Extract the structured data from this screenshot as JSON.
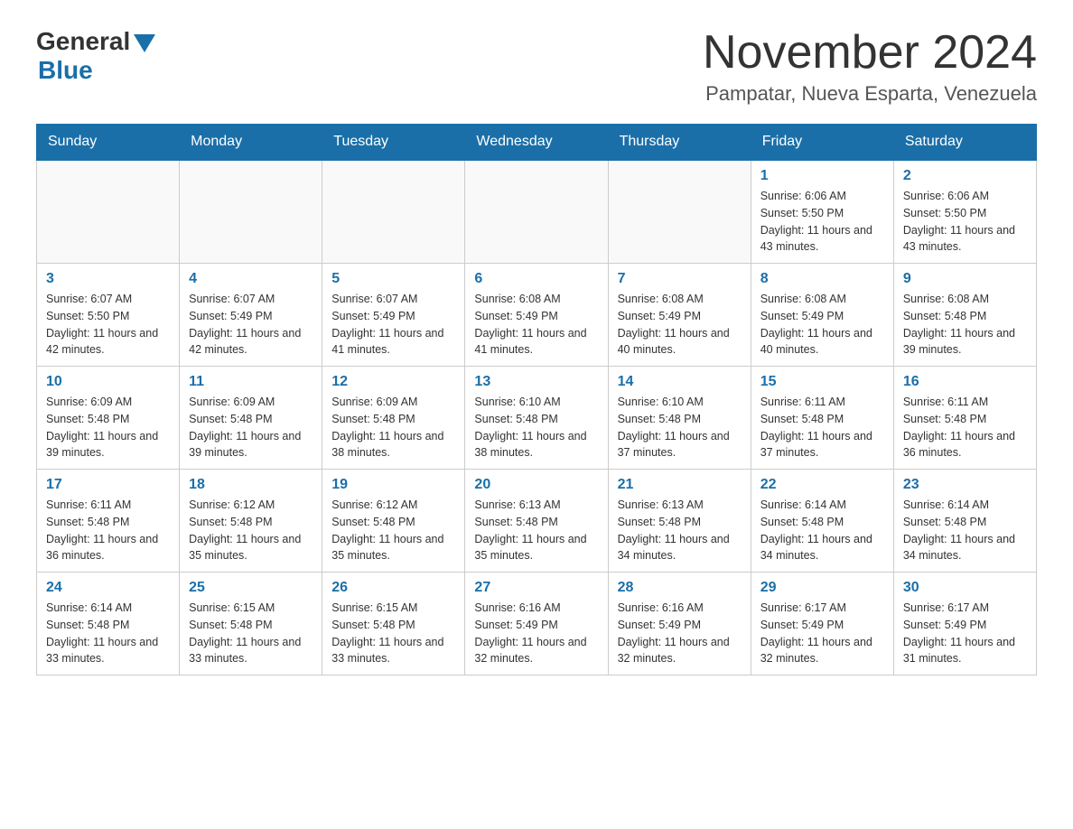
{
  "logo": {
    "general": "General",
    "blue": "Blue"
  },
  "title": "November 2024",
  "location": "Pampatar, Nueva Esparta, Venezuela",
  "days_of_week": [
    "Sunday",
    "Monday",
    "Tuesday",
    "Wednesday",
    "Thursday",
    "Friday",
    "Saturday"
  ],
  "weeks": [
    [
      {
        "day": "",
        "info": ""
      },
      {
        "day": "",
        "info": ""
      },
      {
        "day": "",
        "info": ""
      },
      {
        "day": "",
        "info": ""
      },
      {
        "day": "",
        "info": ""
      },
      {
        "day": "1",
        "info": "Sunrise: 6:06 AM\nSunset: 5:50 PM\nDaylight: 11 hours and 43 minutes."
      },
      {
        "day": "2",
        "info": "Sunrise: 6:06 AM\nSunset: 5:50 PM\nDaylight: 11 hours and 43 minutes."
      }
    ],
    [
      {
        "day": "3",
        "info": "Sunrise: 6:07 AM\nSunset: 5:50 PM\nDaylight: 11 hours and 42 minutes."
      },
      {
        "day": "4",
        "info": "Sunrise: 6:07 AM\nSunset: 5:49 PM\nDaylight: 11 hours and 42 minutes."
      },
      {
        "day": "5",
        "info": "Sunrise: 6:07 AM\nSunset: 5:49 PM\nDaylight: 11 hours and 41 minutes."
      },
      {
        "day": "6",
        "info": "Sunrise: 6:08 AM\nSunset: 5:49 PM\nDaylight: 11 hours and 41 minutes."
      },
      {
        "day": "7",
        "info": "Sunrise: 6:08 AM\nSunset: 5:49 PM\nDaylight: 11 hours and 40 minutes."
      },
      {
        "day": "8",
        "info": "Sunrise: 6:08 AM\nSunset: 5:49 PM\nDaylight: 11 hours and 40 minutes."
      },
      {
        "day": "9",
        "info": "Sunrise: 6:08 AM\nSunset: 5:48 PM\nDaylight: 11 hours and 39 minutes."
      }
    ],
    [
      {
        "day": "10",
        "info": "Sunrise: 6:09 AM\nSunset: 5:48 PM\nDaylight: 11 hours and 39 minutes."
      },
      {
        "day": "11",
        "info": "Sunrise: 6:09 AM\nSunset: 5:48 PM\nDaylight: 11 hours and 39 minutes."
      },
      {
        "day": "12",
        "info": "Sunrise: 6:09 AM\nSunset: 5:48 PM\nDaylight: 11 hours and 38 minutes."
      },
      {
        "day": "13",
        "info": "Sunrise: 6:10 AM\nSunset: 5:48 PM\nDaylight: 11 hours and 38 minutes."
      },
      {
        "day": "14",
        "info": "Sunrise: 6:10 AM\nSunset: 5:48 PM\nDaylight: 11 hours and 37 minutes."
      },
      {
        "day": "15",
        "info": "Sunrise: 6:11 AM\nSunset: 5:48 PM\nDaylight: 11 hours and 37 minutes."
      },
      {
        "day": "16",
        "info": "Sunrise: 6:11 AM\nSunset: 5:48 PM\nDaylight: 11 hours and 36 minutes."
      }
    ],
    [
      {
        "day": "17",
        "info": "Sunrise: 6:11 AM\nSunset: 5:48 PM\nDaylight: 11 hours and 36 minutes."
      },
      {
        "day": "18",
        "info": "Sunrise: 6:12 AM\nSunset: 5:48 PM\nDaylight: 11 hours and 35 minutes."
      },
      {
        "day": "19",
        "info": "Sunrise: 6:12 AM\nSunset: 5:48 PM\nDaylight: 11 hours and 35 minutes."
      },
      {
        "day": "20",
        "info": "Sunrise: 6:13 AM\nSunset: 5:48 PM\nDaylight: 11 hours and 35 minutes."
      },
      {
        "day": "21",
        "info": "Sunrise: 6:13 AM\nSunset: 5:48 PM\nDaylight: 11 hours and 34 minutes."
      },
      {
        "day": "22",
        "info": "Sunrise: 6:14 AM\nSunset: 5:48 PM\nDaylight: 11 hours and 34 minutes."
      },
      {
        "day": "23",
        "info": "Sunrise: 6:14 AM\nSunset: 5:48 PM\nDaylight: 11 hours and 34 minutes."
      }
    ],
    [
      {
        "day": "24",
        "info": "Sunrise: 6:14 AM\nSunset: 5:48 PM\nDaylight: 11 hours and 33 minutes."
      },
      {
        "day": "25",
        "info": "Sunrise: 6:15 AM\nSunset: 5:48 PM\nDaylight: 11 hours and 33 minutes."
      },
      {
        "day": "26",
        "info": "Sunrise: 6:15 AM\nSunset: 5:48 PM\nDaylight: 11 hours and 33 minutes."
      },
      {
        "day": "27",
        "info": "Sunrise: 6:16 AM\nSunset: 5:49 PM\nDaylight: 11 hours and 32 minutes."
      },
      {
        "day": "28",
        "info": "Sunrise: 6:16 AM\nSunset: 5:49 PM\nDaylight: 11 hours and 32 minutes."
      },
      {
        "day": "29",
        "info": "Sunrise: 6:17 AM\nSunset: 5:49 PM\nDaylight: 11 hours and 32 minutes."
      },
      {
        "day": "30",
        "info": "Sunrise: 6:17 AM\nSunset: 5:49 PM\nDaylight: 11 hours and 31 minutes."
      }
    ]
  ]
}
